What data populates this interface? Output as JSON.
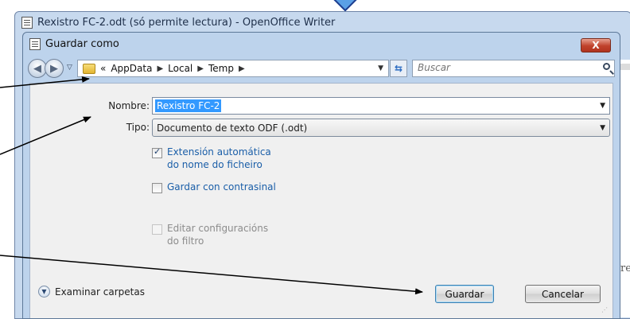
{
  "window": {
    "title": "Rexistro FC-2.odt (só permite lectura) - OpenOffice Writer"
  },
  "dialog": {
    "title": "Guardar como",
    "close_label": "X",
    "address": {
      "overflow": "«",
      "crumbs": [
        "AppData",
        "Local",
        "Temp"
      ]
    },
    "search": {
      "placeholder": "Buscar"
    },
    "name_label": "Nombre:",
    "name_value": "Rexistro FC-2",
    "type_label": "Tipo:",
    "type_value": "Documento de texto ODF (.odt)",
    "options": [
      {
        "line1": "Extensión automática",
        "line2": "do nome do ficheiro",
        "checked": true,
        "enabled": true
      },
      {
        "line1": "Gardar con contrasinal",
        "line2": "",
        "checked": false,
        "enabled": true
      },
      {
        "line1": "Editar configuracións",
        "line2": "do filtro",
        "checked": false,
        "enabled": false
      }
    ],
    "browse_label": "Examinar carpetas",
    "save_label": "Guardar",
    "cancel_label": "Cancelar"
  },
  "background": {
    "doc_char": "re"
  },
  "icons": [
    "writer-doc-icon",
    "back-arrow-icon",
    "forward-arrow-icon",
    "folder-icon",
    "refresh-icon",
    "search-icon",
    "expand-chevron-icon",
    "resize-grip-icon"
  ],
  "colors": {
    "selection": "#3399ff",
    "link_text": "#1a5ea8",
    "close_button": "#c0412b",
    "marker": "#5aa0e6"
  }
}
